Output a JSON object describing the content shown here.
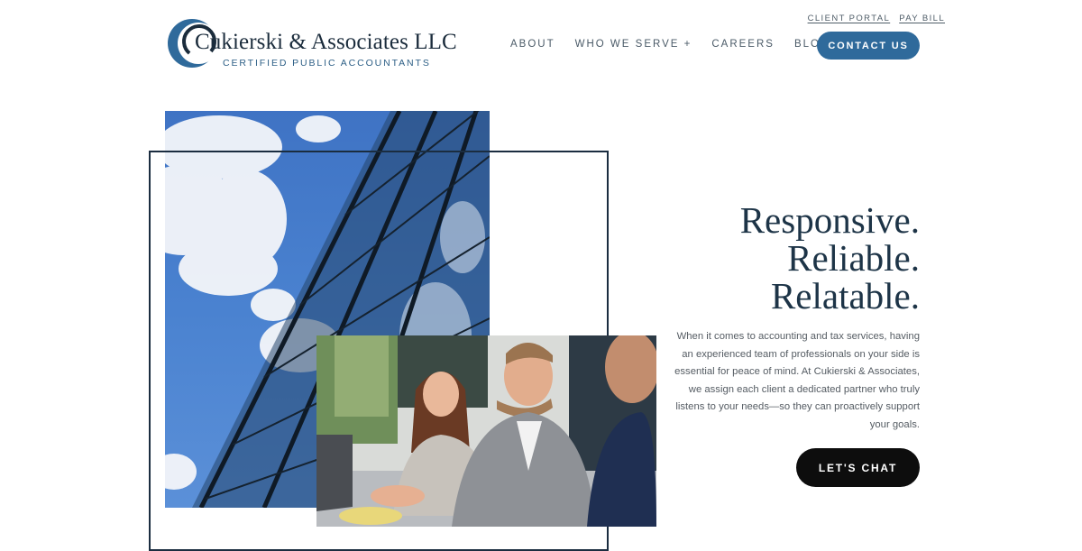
{
  "brand": {
    "name": "Cukierski & Associates LLC",
    "tagline": "CERTIFIED PUBLIC ACCOUNTANTS",
    "logo_icon": "crescent-c-logo-icon",
    "color_primary": "#2f6a9b",
    "color_dark": "#1d3447"
  },
  "utility_links": [
    {
      "label": "CLIENT PORTAL"
    },
    {
      "label": "PAY BILL"
    }
  ],
  "nav": {
    "items": [
      {
        "label": "ABOUT"
      },
      {
        "label": "WHO WE SERVE +"
      },
      {
        "label": "CAREERS"
      },
      {
        "label": "BLOGS"
      }
    ],
    "cta_label": "CONTACT US"
  },
  "hero": {
    "headline": [
      "Responsive.",
      "Reliable.",
      "Relatable."
    ],
    "body": "When it comes to accounting and tax services, having an experienced team of professionals on your side is essential for peace of mind. At Cukierski & Associates, we assign each client a dedicated partner who truly listens to your needs—so they can proactively support your goals.",
    "cta_label": "LET'S CHAT"
  }
}
